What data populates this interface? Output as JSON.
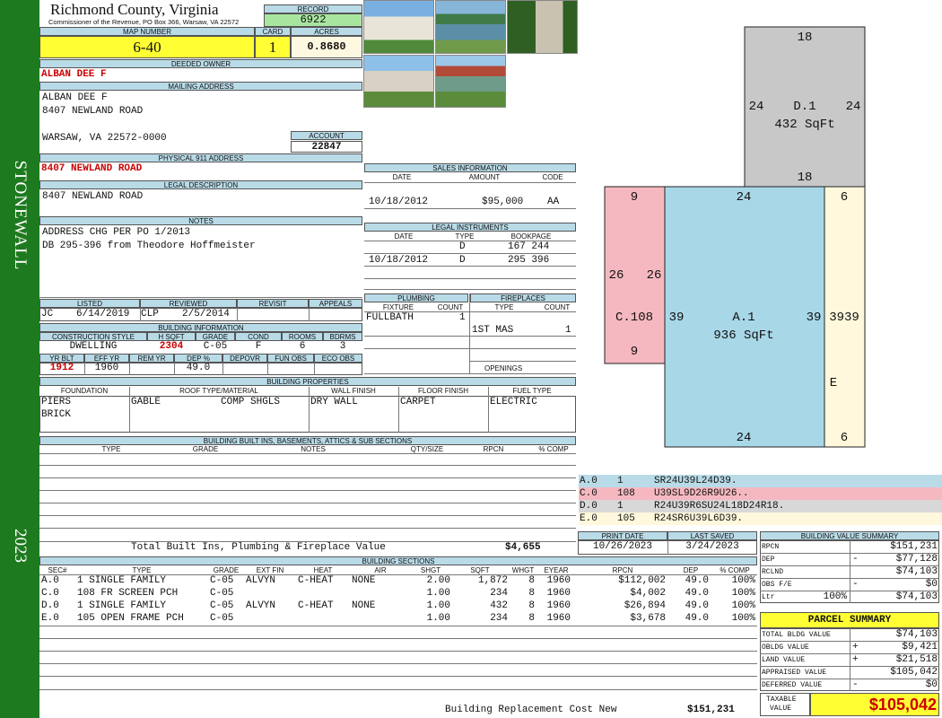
{
  "sidebar": {
    "district": "STONEWALL",
    "year": "2023"
  },
  "header": {
    "county": "Richmond County, Virginia",
    "commissioner": "Commissioner of the Revenue, PO Box 366, Warsaw, VA 22572",
    "record_label": "RECORD",
    "record": "6922",
    "map_label": "MAP NUMBER",
    "map": "6-40",
    "card_label": "CARD",
    "card": "1",
    "acres_label": "ACRES",
    "acres": "0.8680"
  },
  "owner": {
    "label": "DEEDED OWNER",
    "name": "ALBAN DEE F"
  },
  "mailing": {
    "label": "MAILING ADDRESS",
    "line1": "ALBAN DEE F",
    "line2": "8407 NEWLAND ROAD",
    "line3": "WARSAW, VA 22572-0000",
    "account_label": "ACCOUNT",
    "account": "22847"
  },
  "physical": {
    "label": "PHYSICAL 911 ADDRESS",
    "address": "8407 NEWLAND ROAD"
  },
  "legal": {
    "label": "LEGAL DESCRIPTION",
    "text": "8407 NEWLAND ROAD"
  },
  "notes": {
    "label": "NOTES",
    "line1": "ADDRESS CHG PER PO 1/2013",
    "line2": "DB 295-396 from Theodore Hoffmeister"
  },
  "listing": {
    "listed_label": "LISTED",
    "reviewed_label": "REVIEWED",
    "revisit_label": "REVISIT",
    "appeals_label": "APPEALS",
    "listed_by": "JC",
    "listed_date": "6/14/2019",
    "reviewed_by": "CLP",
    "reviewed_date": "2/5/2014"
  },
  "building_info": {
    "label": "BUILDING INFORMATION",
    "construction_style_label": "CONSTRUCTION STYLE",
    "h_sqft_label": "H SQFT",
    "grade_label": "GRADE",
    "cond_label": "COND",
    "rooms_label": "ROOMS",
    "bdrms_label": "BDRMS",
    "construction_style": "DWELLING",
    "h_sqft": "2304",
    "grade": "C-05",
    "cond": "F",
    "rooms": "6",
    "bdrms": "3",
    "yr_blt_label": "YR BLT",
    "eff_yr_label": "EFF YR",
    "rem_yr_label": "REM YR",
    "dep_label": "DEP %",
    "depovr_label": "DEPOVR",
    "fun_obs_label": "FUN OBS",
    "eco_obs_label": "ECO OBS",
    "yr_blt": "1912",
    "eff_yr": "1960",
    "dep": "49.0"
  },
  "sales": {
    "label": "SALES INFORMATION",
    "date_label": "DATE",
    "amount_label": "AMOUNT",
    "code_label": "CODE",
    "date": "10/18/2012",
    "amount": "$95,000",
    "code": "AA"
  },
  "legal_instruments": {
    "label": "LEGAL INSTRUMENTS",
    "date_label": "DATE",
    "type_label": "TYPE",
    "bookpage_label": "BOOKPAGE",
    "rows": [
      {
        "date": "",
        "type": "D",
        "bookpage": "167 244"
      },
      {
        "date": "10/18/2012",
        "type": "D",
        "bookpage": "295 396"
      }
    ]
  },
  "plumbing": {
    "label": "PLUMBING",
    "fixture_label": "FIXTURE",
    "count_label": "COUNT",
    "fixture": "FULLBATH",
    "count": "1"
  },
  "fireplaces": {
    "label": "FIREPLACES",
    "type_label": "TYPE",
    "count_label": "COUNT",
    "type": "1ST MAS",
    "count": "1",
    "openings_label": "OPENINGS"
  },
  "properties": {
    "label": "BUILDING PROPERTIES",
    "foundation_label": "FOUNDATION",
    "roof_label": "ROOF TYPE/MATERIAL",
    "wall_label": "WALL FINISH",
    "floor_label": "FLOOR FINISH",
    "fuel_label": "FUEL TYPE",
    "foundation1": "PIERS",
    "foundation2": "BRICK",
    "roof_type": "GABLE",
    "roof_material": "COMP SHGLS",
    "wall": "DRY WALL",
    "floor": "CARPET",
    "fuel": "ELECTRIC"
  },
  "built_ins": {
    "label": "BUILDING BUILT INS, BASEMENTS, ATTICS & SUB SECTIONS",
    "type_label": "TYPE",
    "grade_label": "GRADE",
    "notes_label": "NOTES",
    "qty_label": "QTY/SIZE",
    "rpcn_label": "RPCN",
    "comp_label": "% COMP",
    "total_label": "Total Built Ins, Plumbing & Fireplace Value",
    "total": "$4,655"
  },
  "sketch": {
    "labels": {
      "d1_name": "D.1",
      "d1_area": "432 SqFt",
      "d1_top": "18",
      "d1_bottom": "18",
      "d1_left": "24",
      "d1_right": "24",
      "a1_name": "A.1",
      "a1_area": "936 SqFt",
      "a1_top": "24",
      "a1_bottom": "24",
      "a1_left": "39",
      "a1_right": "39",
      "c_name": "C.108",
      "c_top": "9",
      "c_bottom": "9",
      "c_left": "26",
      "c_right": "26",
      "e_name": "E",
      "e_top": "6",
      "e_bottom": "6",
      "e_side": "3939"
    },
    "colors": {
      "d": "#c8c8c8",
      "a": "#a8d8e8",
      "c": "#f6b8c0",
      "e": "#fff8dc"
    }
  },
  "legend": [
    {
      "code": "A.0",
      "num": "1",
      "path": "SR24U39L24D39.",
      "color": "#b9dbe8"
    },
    {
      "code": "C.0",
      "num": "108",
      "path": "U39SL9D26R9U26..",
      "color": "#f6b8c0"
    },
    {
      "code": "D.0",
      "num": "1",
      "path": "R24U39R6SU24L18D24R18.",
      "color": "#d8d8d8"
    },
    {
      "code": "E.0",
      "num": "105",
      "path": "R24SR6U39L6D39.",
      "color": "#fff8dc"
    }
  ],
  "print": {
    "print_date_label": "PRINT DATE",
    "last_saved_label": "LAST SAVED",
    "print_date": "10/26/2023",
    "last_saved": "3/24/2023"
  },
  "value_summary": {
    "label": "BUILDING VALUE SUMMARY",
    "rows": [
      {
        "label": "RPCN",
        "sign": "",
        "pct": "",
        "value": "$151,231"
      },
      {
        "label": "DEP",
        "sign": "-",
        "pct": "",
        "value": "$77,128"
      },
      {
        "label": "RCLND",
        "sign": "",
        "pct": "",
        "value": "$74,103"
      },
      {
        "label": "OBS F/E",
        "sign": "-",
        "pct": "",
        "value": "$0"
      },
      {
        "label": "Ltr",
        "sign": "",
        "pct": "100%",
        "value": "$74,103"
      }
    ]
  },
  "parcel_summary": {
    "label": "PARCEL SUMMARY",
    "rows": [
      {
        "label": "TOTAL BLDG VALUE",
        "sign": "",
        "value": "$74,103"
      },
      {
        "label": "OBLDG VALUE",
        "sign": "+",
        "value": "$9,421"
      },
      {
        "label": "LAND VALUE",
        "sign": "+",
        "value": "$21,518"
      },
      {
        "label": "APPRAISED VALUE",
        "sign": "",
        "value": "$105,042"
      },
      {
        "label": "DEFERRED VALUE",
        "sign": "-",
        "value": "$0"
      }
    ],
    "taxable_label1": "TAXABLE",
    "taxable_label2": "VALUE",
    "taxable": "$105,042"
  },
  "sections": {
    "label": "BUILDING SECTIONS",
    "headers": [
      "SEC#",
      "TYPE",
      "GRADE",
      "EXT FIN",
      "HEAT",
      "AIR",
      "SHGT",
      "SQFT",
      "WHGT",
      "EYEAR",
      "RPCN",
      "DEP",
      "% COMP"
    ],
    "rows": [
      {
        "sec": "A.0",
        "type": "1 SINGLE FAMILY",
        "grade": "C-05",
        "ext": "ALVYN",
        "heat": "C-HEAT",
        "air": "NONE",
        "shgt": "2.00",
        "sqft": "1,872",
        "whgt": "8",
        "eyear": "1960",
        "rpcn": "$112,002",
        "dep": "49.0",
        "comp": "100%"
      },
      {
        "sec": "C.0",
        "type": "108 FR SCREEN PCH",
        "grade": "C-05",
        "ext": "",
        "heat": "",
        "air": "",
        "shgt": "1.00",
        "sqft": "234",
        "whgt": "8",
        "eyear": "1960",
        "rpcn": "$4,002",
        "dep": "49.0",
        "comp": "100%"
      },
      {
        "sec": "D.0",
        "type": "1 SINGLE FAMILY",
        "grade": "C-05",
        "ext": "ALVYN",
        "heat": "C-HEAT",
        "air": "NONE",
        "shgt": "1.00",
        "sqft": "432",
        "whgt": "8",
        "eyear": "1960",
        "rpcn": "$26,894",
        "dep": "49.0",
        "comp": "100%"
      },
      {
        "sec": "E.0",
        "type": "105 OPEN FRAME PCH",
        "grade": "C-05",
        "ext": "",
        "heat": "",
        "air": "",
        "shgt": "1.00",
        "sqft": "234",
        "whgt": "8",
        "eyear": "1960",
        "rpcn": "$3,678",
        "dep": "49.0",
        "comp": "100%"
      }
    ],
    "replacement_label": "Building Replacement Cost New",
    "replacement": "$151,231"
  }
}
